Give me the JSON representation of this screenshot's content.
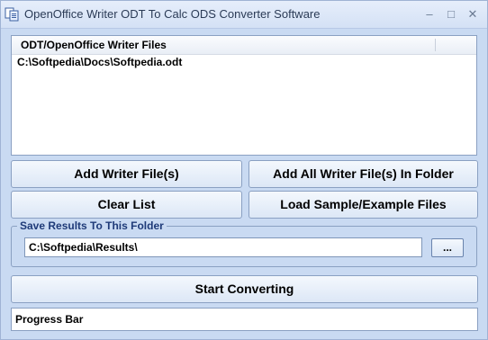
{
  "window": {
    "title": "OpenOffice Writer ODT To Calc ODS Converter Software",
    "controls": {
      "minimize": "–",
      "maximize": "□",
      "close": "✕"
    }
  },
  "file_list": {
    "column_header": "ODT/OpenOffice Writer Files",
    "items": [
      "C:\\Softpedia\\Docs\\Softpedia.odt"
    ]
  },
  "buttons": {
    "add_files": "Add Writer File(s)",
    "add_folder": "Add All Writer File(s) In Folder",
    "clear_list": "Clear List",
    "load_samples": "Load Sample/Example Files",
    "start": "Start Converting"
  },
  "output": {
    "group_label": "Save Results To This Folder",
    "folder_value": "C:\\Softpedia\\Results\\",
    "browse_label": "..."
  },
  "progress": {
    "label": "Progress Bar",
    "value": 0
  },
  "icons": {
    "app": "converter-app-icon"
  },
  "colors": {
    "window_bg": "#c9daf2",
    "group_label": "#1e3a78",
    "button_border": "#8aa0c2"
  }
}
